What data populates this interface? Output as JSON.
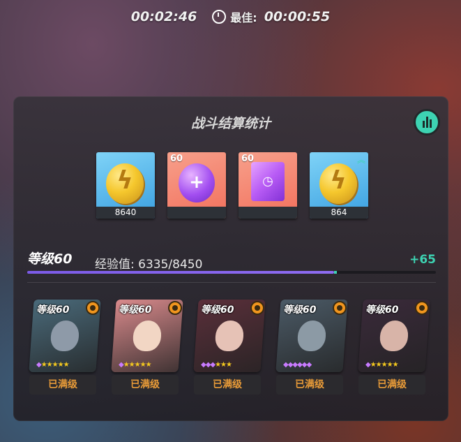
{
  "timer": {
    "elapsed": "00:02:46",
    "best_label": "最佳:",
    "best_time": "00:00:55"
  },
  "panel": {
    "title": "战斗结算统计"
  },
  "rewards": [
    {
      "icon": "gold-coin-icon",
      "count": "8640",
      "badge": ""
    },
    {
      "icon": "purple-orb-icon",
      "count": "",
      "badge": "60"
    },
    {
      "icon": "purple-timer-cube-icon",
      "count": "",
      "badge": "60"
    },
    {
      "icon": "gold-coin-icon",
      "count": "864",
      "badge": ""
    }
  ],
  "level": {
    "label": "等级60",
    "exp_label": "经验值: 6335/8450",
    "exp_gain": "+65",
    "progress": 0.75
  },
  "heroes": [
    {
      "level": "等级60",
      "status": "已满级",
      "bg": "#4a6a7a",
      "face": "#8e9aa8"
    },
    {
      "level": "等级60",
      "status": "已满级",
      "bg": "#d98a8c",
      "face": "#f2d6c4"
    },
    {
      "level": "等级60",
      "status": "已满级",
      "bg": "#5a2f3a",
      "face": "#e6c2b6"
    },
    {
      "level": "等级60",
      "status": "已满级",
      "bg": "#4b5a66",
      "face": "#8c9aa5"
    },
    {
      "level": "等级60",
      "status": "已满级",
      "bg": "#3a2a3a",
      "face": "#d8b4a8"
    }
  ],
  "colors": {
    "accent": "#3dd3b2",
    "exp_bar": "#7c5be8",
    "status_text": "#e89b38"
  }
}
